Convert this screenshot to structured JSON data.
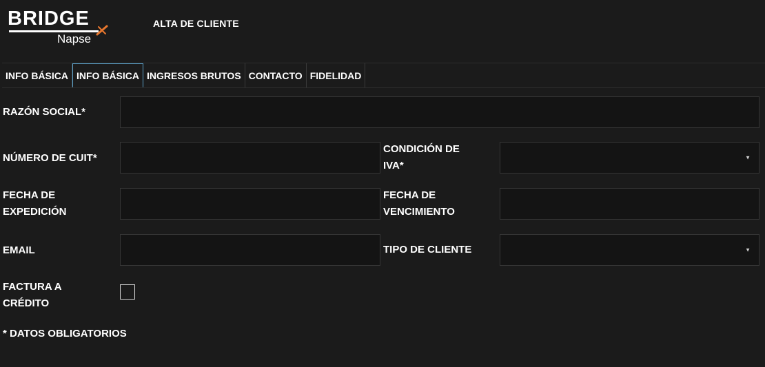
{
  "app": {
    "logo_text": "BRIDGE",
    "logo_subtext": "Napse",
    "accent_color": "#e8772e"
  },
  "header": {
    "title": "ALTA DE CLIENTE"
  },
  "tabs": [
    {
      "label": "INFO BÁSICA",
      "active": false
    },
    {
      "label": "INFO BÁSICA",
      "active": true
    },
    {
      "label": "INGRESOS BRUTOS",
      "active": false
    },
    {
      "label": "CONTACTO",
      "active": false
    },
    {
      "label": "FIDELIDAD",
      "active": false
    }
  ],
  "form": {
    "razon_social": {
      "label": "RAZÓN SOCIAL*",
      "value": "",
      "placeholder": ""
    },
    "numero_cuit": {
      "label": "NÚMERO DE CUIT*",
      "value": "",
      "placeholder": ""
    },
    "condicion_iva": {
      "label_line1": "CONDICIÓN DE",
      "label_line2": "IVA*",
      "selected": ""
    },
    "fecha_expedicion": {
      "label_line1": "FECHA DE",
      "label_line2": "EXPEDICIÓN",
      "value": ""
    },
    "fecha_vencimiento": {
      "label_line1": "FECHA DE",
      "label_line2": "VENCIMIENTO",
      "value": ""
    },
    "email": {
      "label": "EMAIL",
      "value": "",
      "placeholder": ""
    },
    "tipo_cliente": {
      "label": "TIPO DE CLIENTE",
      "selected": ""
    },
    "factura_credito": {
      "label_line1": "FACTURA A",
      "label_line2": "CRÉDITO",
      "checked": false
    }
  },
  "footnote": "* DATOS OBLIGATORIOS",
  "icons": {
    "caret": "▼"
  }
}
